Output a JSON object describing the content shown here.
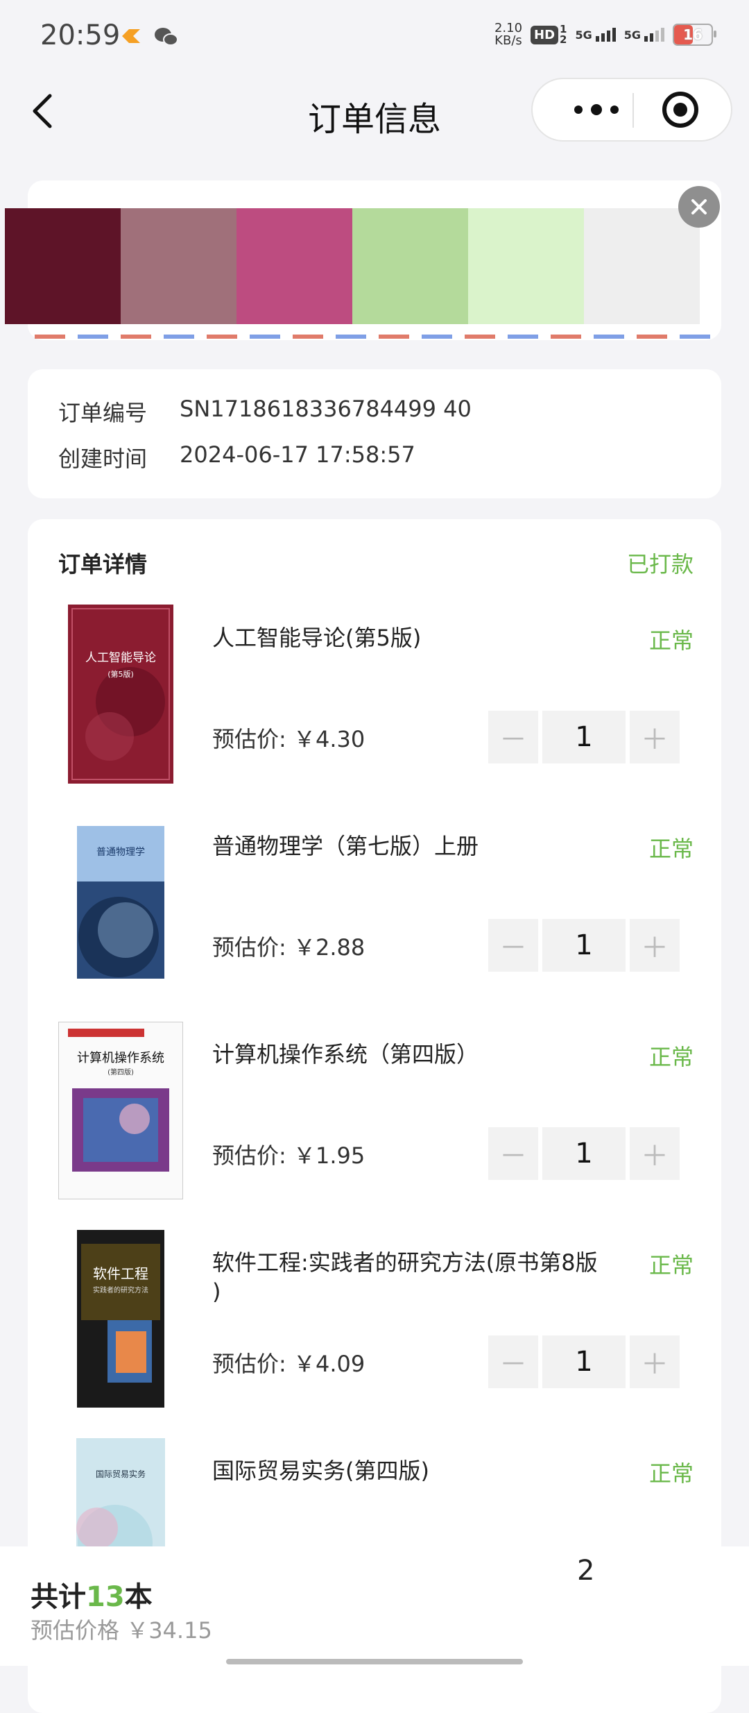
{
  "status_bar": {
    "time": "20:59",
    "net_speed_value": "2.10",
    "net_speed_unit": "KB/s",
    "hd_label": "HD",
    "sim1": "1",
    "sim2": "2",
    "signal1_label": "5G",
    "signal2_label": "5G",
    "battery": "16"
  },
  "nav": {
    "title": "订单信息"
  },
  "palette": {
    "colors": [
      "#5e1428",
      "#a0707a",
      "#bd4c80",
      "#b4da9b",
      "#daf3cb",
      "#eeeeee"
    ]
  },
  "order_info": {
    "number_label": "订单编号",
    "number_value": "SN1718618336784499 40",
    "created_label": "创建时间",
    "created_value": "2024-06-17 17:58:57"
  },
  "details": {
    "title": "订单详情",
    "status": "已打款",
    "items": [
      {
        "name": "人工智能导论(第5版)",
        "status": "正常",
        "price_label": "预估价:",
        "price": "￥4.30",
        "qty": "1",
        "minus": "－",
        "plus": "＋"
      },
      {
        "name": "普通物理学（第七版）上册",
        "status": "正常",
        "price_label": "预估价:",
        "price": "￥2.88",
        "qty": "1",
        "minus": "－",
        "plus": "＋"
      },
      {
        "name": "计算机操作系统（第四版）",
        "status": "正常",
        "price_label": "预估价:",
        "price": "￥1.95",
        "qty": "1",
        "minus": "－",
        "plus": "＋"
      },
      {
        "name": "软件工程:实践者的研究方法(原书第8版 )",
        "status": "正常",
        "price_label": "预估价:",
        "price": "￥4.09",
        "qty": "1",
        "minus": "－",
        "plus": "＋"
      },
      {
        "name": "国际贸易实务(第四版)",
        "status": "正常"
      }
    ],
    "cover_texts": {
      "c1_title": "人工智能导论",
      "c1_sub": "(第5版)",
      "c2_title": "普通物理学",
      "c3_title": "计算机操作系统",
      "c3_sub": "(第四版)",
      "c4_title": "软件工程",
      "c4_sub": "实践者的研究方法",
      "c5_title": "国际贸易实务"
    }
  },
  "footer": {
    "total_prefix": "共计",
    "total_count": "13",
    "total_suffix": "本",
    "est_label": "预估价格",
    "est_value": "￥34.15",
    "page_num": "2"
  }
}
